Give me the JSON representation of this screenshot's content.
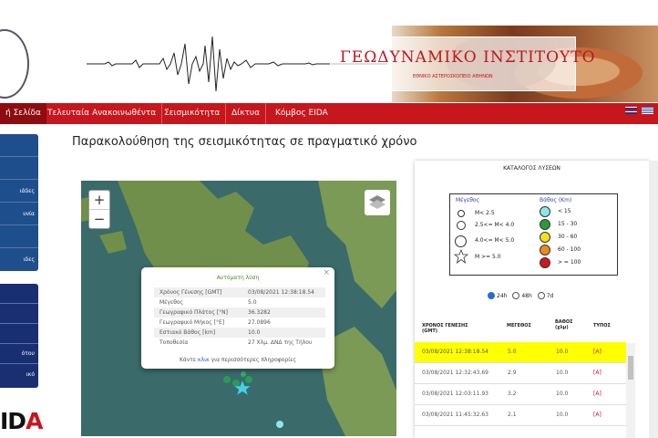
{
  "banner": {
    "institute_title": "ΓΕΩΔΥΝΑΜΙΚΟ ΙΝΣΤΙΤΟΥΤΟ",
    "institute_subtitle": "ΕΘΝΙΚΟ ΑΣΤΕΡΟΣΚΟΠΕΙΟ ΑΘΗΝΩΝ"
  },
  "nav": {
    "items": [
      "ή Σελίδα",
      "Τελευταία Ανακοινωθέντα",
      "Σεισμικότητα",
      "Δίκτυα",
      "Κόμβος EIDA"
    ]
  },
  "sidebar": {
    "items_top": [
      "",
      "",
      "ιάδες",
      "υνία",
      "",
      "ιδες"
    ],
    "items_bottom": [
      "",
      "",
      "",
      "ότου",
      "ικό"
    ]
  },
  "eida_logo": {
    "part1": "ID",
    "part2": "A"
  },
  "page_title": "Παρακολούθηση της σεισμικότητας σε πραγματικό χρόνο",
  "map": {
    "zoom_in": "+",
    "zoom_out": "−",
    "popup": {
      "close": "×",
      "title": "Αυτόματη λύση",
      "rows": [
        {
          "label": "Χρόνος Γένεσης [GMT]",
          "value": "03/08/2021 12:38:18.54"
        },
        {
          "label": "Μέγεθος",
          "value": "5.0"
        },
        {
          "label": "Γεωγραφικό Πλάτος [°N]",
          "value": "36.3282"
        },
        {
          "label": "Γεωγραφικό Μήκος [°E]",
          "value": "27.0896"
        },
        {
          "label": "Εστιακό Βάθος [km]",
          "value": "10.0"
        },
        {
          "label": "Τοποθεσία",
          "value": "27 Χλμ. ΔΝΔ της Τήλου"
        }
      ],
      "more_pre": "Κάντε ",
      "more_link": "κλικ",
      "more_post": " για περισσότερες πληροφορίες"
    }
  },
  "catalog": {
    "title": "ΚΑΤΑΛΟΓΟΣ ΛΥΣΕΩΝ",
    "legend": {
      "magnitude_head": "Μέγεθος",
      "depth_head": "Βάθος (Km)",
      "magnitudes": [
        "M< 2.5",
        "2.5<= M< 4.0",
        "4.0<= M< 5.0",
        "M >= 5.0"
      ],
      "depths": [
        {
          "label": "< 15",
          "color": "#8fe6e6"
        },
        {
          "label": "15 - 30",
          "color": "#2a9a3a"
        },
        {
          "label": "30 - 60",
          "color": "#f0e020"
        },
        {
          "label": "60 - 100",
          "color": "#f08a1a"
        },
        {
          "label": "> = 100",
          "color": "#d0161c"
        }
      ]
    },
    "ranges": [
      {
        "label": "24h",
        "selected": true
      },
      {
        "label": "48h",
        "selected": false
      },
      {
        "label": "7d",
        "selected": false
      }
    ],
    "headers": {
      "time": "ΧΡΟΝΟΣ ΓΕΝΕΣΗΣ",
      "time_unit": "(GMT)",
      "magnitude": "ΜΕΓΕΘΟΣ",
      "depth": "ΒΑΘΟΣ",
      "depth_unit": "(χλμ)",
      "type": "ΤΥΠΟΣ"
    },
    "rows": [
      {
        "time": "03/08/2021 12:38:18.54",
        "magnitude": "5.0",
        "depth": "10.0",
        "type": "[A]",
        "highlight": true
      },
      {
        "time": "03/08/2021 12:32:43.69",
        "magnitude": "2.9",
        "depth": "10.0",
        "type": "[A]",
        "highlight": false
      },
      {
        "time": "03/08/2021 12:03:11.93",
        "magnitude": "3.2",
        "depth": "10.0",
        "type": "[A]",
        "highlight": false
      },
      {
        "time": "03/08/2021 11:45:32.63",
        "magnitude": "2.1",
        "depth": "10.0",
        "type": "[A]",
        "highlight": false
      }
    ]
  }
}
